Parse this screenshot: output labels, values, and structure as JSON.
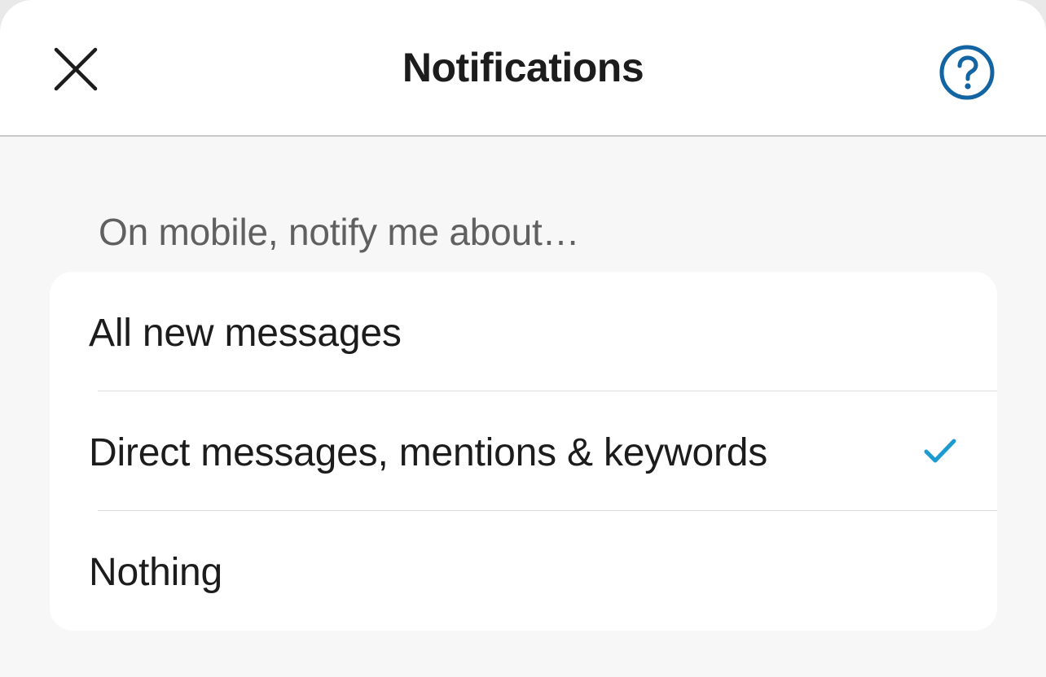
{
  "header": {
    "title": "Notifications",
    "close_icon": "close-icon",
    "help_icon": "help-question-icon"
  },
  "section": {
    "label": "On mobile, notify me about…"
  },
  "options": [
    {
      "label": "All new messages",
      "selected": false
    },
    {
      "label": "Direct messages, mentions & keywords",
      "selected": true
    },
    {
      "label": "Nothing",
      "selected": false
    }
  ],
  "colors": {
    "accent_blue": "#1264a3",
    "check_blue": "#1d9bd1",
    "text_primary": "#1d1c1d",
    "text_secondary": "#616061",
    "background": "#f7f7f7"
  }
}
